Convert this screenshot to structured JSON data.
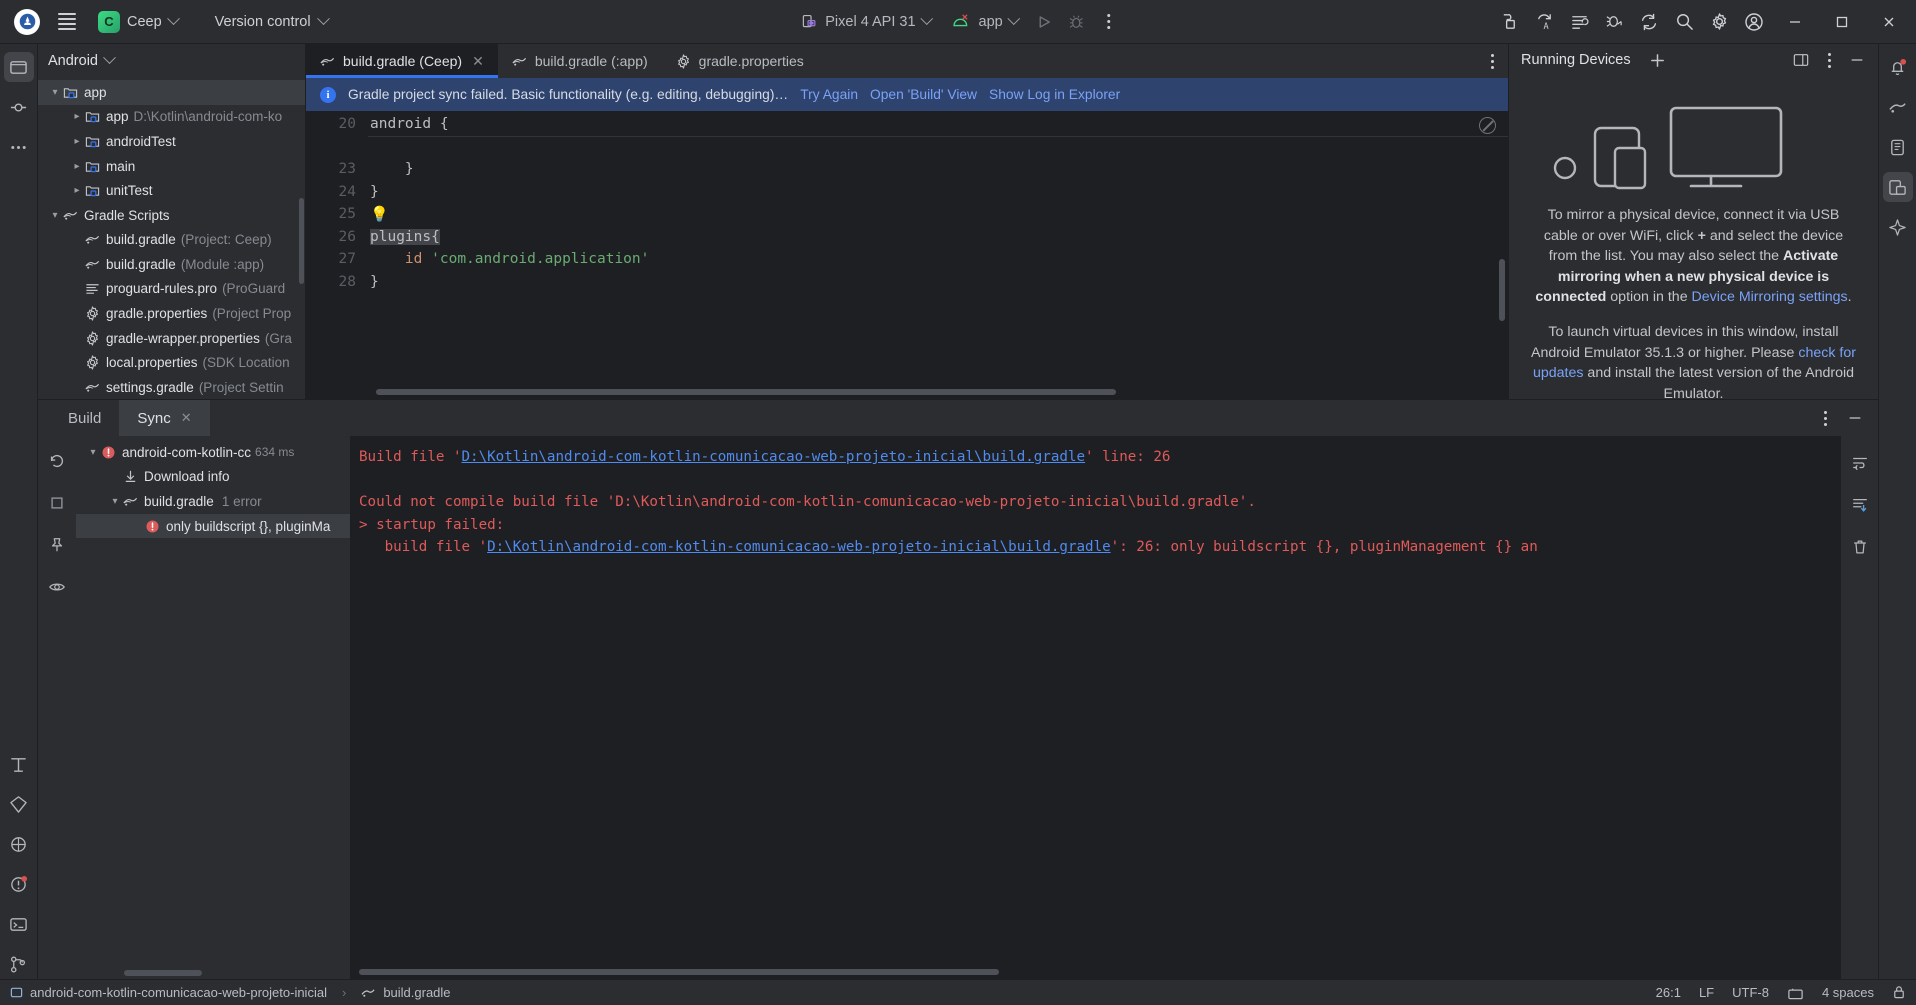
{
  "window": {
    "app_icon": "android-studio-icon",
    "project_initial": "C",
    "project_name": "Ceep",
    "version_control_label": "Version control",
    "device_label": "Pixel 4 API 31",
    "run_config_label": "app",
    "minimize_label": "–",
    "maximize_label": "□",
    "close_label": "✕"
  },
  "toolbar_icons": {
    "main_menu": "hamburger-icon",
    "run": "run-icon",
    "debug": "debug-icon",
    "more": "more-vertical-icon",
    "make_project": "build-hammer-icon",
    "code_with_me": "code-with-me-icon",
    "gradle_sync": "sync-gradle-icon",
    "app_inspection": "app-inspection-icon",
    "device_manager": "device-manager-icon",
    "search": "search-icon",
    "settings": "gear-icon",
    "account": "account-icon"
  },
  "project_pane": {
    "view_title": "Android",
    "tree": [
      {
        "indent": 0,
        "arrow": "down",
        "icon": "module-folder-icon",
        "label": "app",
        "sub": "",
        "selected": true
      },
      {
        "indent": 1,
        "arrow": "right",
        "icon": "module-folder-icon",
        "label": "app",
        "sub": "D:\\Kotlin\\android-com-ko",
        "selected": false
      },
      {
        "indent": 1,
        "arrow": "right",
        "icon": "module-folder-icon",
        "label": "androidTest",
        "sub": "",
        "selected": false
      },
      {
        "indent": 1,
        "arrow": "right",
        "icon": "module-folder-icon",
        "label": "main",
        "sub": "",
        "selected": false
      },
      {
        "indent": 1,
        "arrow": "right",
        "icon": "module-folder-icon",
        "label": "unitTest",
        "sub": "",
        "selected": false
      },
      {
        "indent": 0,
        "arrow": "down",
        "icon": "gradle-icon",
        "label": "Gradle Scripts",
        "sub": "",
        "selected": false
      },
      {
        "indent": 1,
        "arrow": "none",
        "icon": "gradle-icon",
        "label": "build.gradle",
        "sub": "(Project: Ceep)",
        "selected": false
      },
      {
        "indent": 1,
        "arrow": "none",
        "icon": "gradle-icon",
        "label": "build.gradle",
        "sub": "(Module :app)",
        "selected": false
      },
      {
        "indent": 1,
        "arrow": "none",
        "icon": "text-file-icon",
        "label": "proguard-rules.pro",
        "sub": "(ProGuard",
        "selected": false
      },
      {
        "indent": 1,
        "arrow": "none",
        "icon": "properties-icon",
        "label": "gradle.properties",
        "sub": "(Project Prop",
        "selected": false
      },
      {
        "indent": 1,
        "arrow": "none",
        "icon": "properties-icon",
        "label": "gradle-wrapper.properties",
        "sub": "(Gra",
        "selected": false
      },
      {
        "indent": 1,
        "arrow": "none",
        "icon": "properties-icon",
        "label": "local.properties",
        "sub": "(SDK Location",
        "selected": false
      },
      {
        "indent": 1,
        "arrow": "none",
        "icon": "gradle-icon",
        "label": "settings.gradle",
        "sub": "(Project Settin",
        "selected": false
      }
    ]
  },
  "editor": {
    "tabs": [
      {
        "icon": "gradle-icon",
        "label": "build.gradle (Ceep)",
        "active": true,
        "closable": true
      },
      {
        "icon": "gradle-icon",
        "label": "build.gradle (:app)",
        "active": false,
        "closable": false
      },
      {
        "icon": "properties-icon",
        "label": "gradle.properties",
        "active": false,
        "closable": false
      }
    ],
    "tab_options_icon": "more-vertical-icon",
    "banner": {
      "icon": "info-icon",
      "message": "Gradle project sync failed. Basic functionality (e.g. editing, debugging)…",
      "actions": [
        "Try Again",
        "Open 'Build' View",
        "Show Log in Explorer"
      ]
    },
    "lines": [
      {
        "num": "20",
        "text": "android {",
        "kind": "plain"
      },
      {
        "num": "",
        "text": "",
        "kind": "fold"
      },
      {
        "num": "23",
        "text": "    }",
        "kind": "plain"
      },
      {
        "num": "24",
        "text": "}",
        "kind": "plain"
      },
      {
        "num": "25",
        "text": "",
        "kind": "bulb"
      },
      {
        "num": "26",
        "text": "plugins{",
        "kind": "selected"
      },
      {
        "num": "27",
        "text": "    id 'com.android.application'",
        "kind": "string"
      },
      {
        "num": "28",
        "text": "}",
        "kind": "plain"
      }
    ],
    "readonly_icon": "no-edit-icon"
  },
  "running_devices": {
    "title": "Running Devices",
    "add_icon": "plus-icon",
    "split_icon": "split-window-icon",
    "options_icon": "more-vertical-icon",
    "minimize_icon": "minimize-icon",
    "paragraph_1_part1": "To mirror a physical device, connect it via USB cable or over WiFi, click ",
    "paragraph_1_plus": "+",
    "paragraph_1_part2": " and select the device from the list. You may also select the ",
    "paragraph_1_bold": "Activate mirroring when a new physical device is connected",
    "paragraph_1_part3": " option in the ",
    "paragraph_1_link": "Device Mirroring settings",
    "paragraph_1_part4": ".",
    "paragraph_2_part1": "To launch virtual devices in this window, install Android Emulator 35.1.3 or higher. Please ",
    "paragraph_2_link": "check for updates",
    "paragraph_2_part2": " and install the latest version of the Android Emulator."
  },
  "build_panel": {
    "tabs": [
      {
        "label": "Build",
        "active": false,
        "closable": false
      },
      {
        "label": "Sync",
        "active": true,
        "closable": true
      }
    ],
    "actions": {
      "options_icon": "more-vertical-icon",
      "minimize_icon": "minimize-icon"
    },
    "side_icons": [
      "restart-icon",
      "stop-icon",
      "pin-icon",
      "eye-icon"
    ],
    "right_icons": [
      "soft-wrap-icon",
      "scroll-to-end-icon",
      "trash-icon"
    ],
    "tree": [
      {
        "indent": 0,
        "arrow": "down",
        "icon": "error-icon",
        "label": "android-com-kotlin-cc",
        "meta": "634 ms",
        "selected": false
      },
      {
        "indent": 1,
        "arrow": "none",
        "icon": "download-icon",
        "label": "Download info",
        "meta": "",
        "selected": false
      },
      {
        "indent": 1,
        "arrow": "down",
        "icon": "gradle-icon",
        "label": "build.gradle",
        "meta": "1 error",
        "selected": false
      },
      {
        "indent": 2,
        "arrow": "none",
        "icon": "error-icon",
        "label": "only buildscript {}, pluginMa",
        "meta": "",
        "selected": true
      }
    ],
    "console": [
      {
        "segments": [
          {
            "t": "Build file '",
            "c": "red"
          },
          {
            "t": "D:\\Kotlin\\android-com-kotlin-comunicacao-web-projeto-inicial\\build.gradle",
            "c": "link"
          },
          {
            "t": "' line: 26",
            "c": "red"
          }
        ]
      },
      {
        "segments": [
          {
            "t": "",
            "c": "red"
          }
        ]
      },
      {
        "segments": [
          {
            "t": "Could not compile build file 'D:\\Kotlin\\android-com-kotlin-comunicacao-web-projeto-inicial\\build.gradle'.",
            "c": "red"
          }
        ]
      },
      {
        "segments": [
          {
            "t": "> startup failed:",
            "c": "red"
          }
        ]
      },
      {
        "segments": [
          {
            "t": "   build file '",
            "c": "red"
          },
          {
            "t": "D:\\Kotlin\\android-com-kotlin-comunicacao-web-projeto-inicial\\build.gradle",
            "c": "link"
          },
          {
            "t": "': 26: only buildscript {}, pluginManagement {} an",
            "c": "red"
          }
        ]
      }
    ]
  },
  "status_bar": {
    "breadcrumb_project_icon": "module-icon",
    "breadcrumb_project": "android-com-kotlin-comunicacao-web-projeto-inicial",
    "breadcrumb_separator": "›",
    "breadcrumb_file_icon": "gradle-icon",
    "breadcrumb_file": "build.gradle",
    "caret_position": "26:1",
    "line_separator": "LF",
    "encoding": "UTF-8",
    "readonly_toggle_icon": "lock-open-icon",
    "indent": "4 spaces",
    "lock_icon": "lock-icon"
  },
  "colors": {
    "accent_blue": "#3574f0",
    "link_blue": "#7aa2f7",
    "error_red": "#e05a5a",
    "gradle_green": "#3ddc84",
    "banner_bg": "#2e436e"
  }
}
